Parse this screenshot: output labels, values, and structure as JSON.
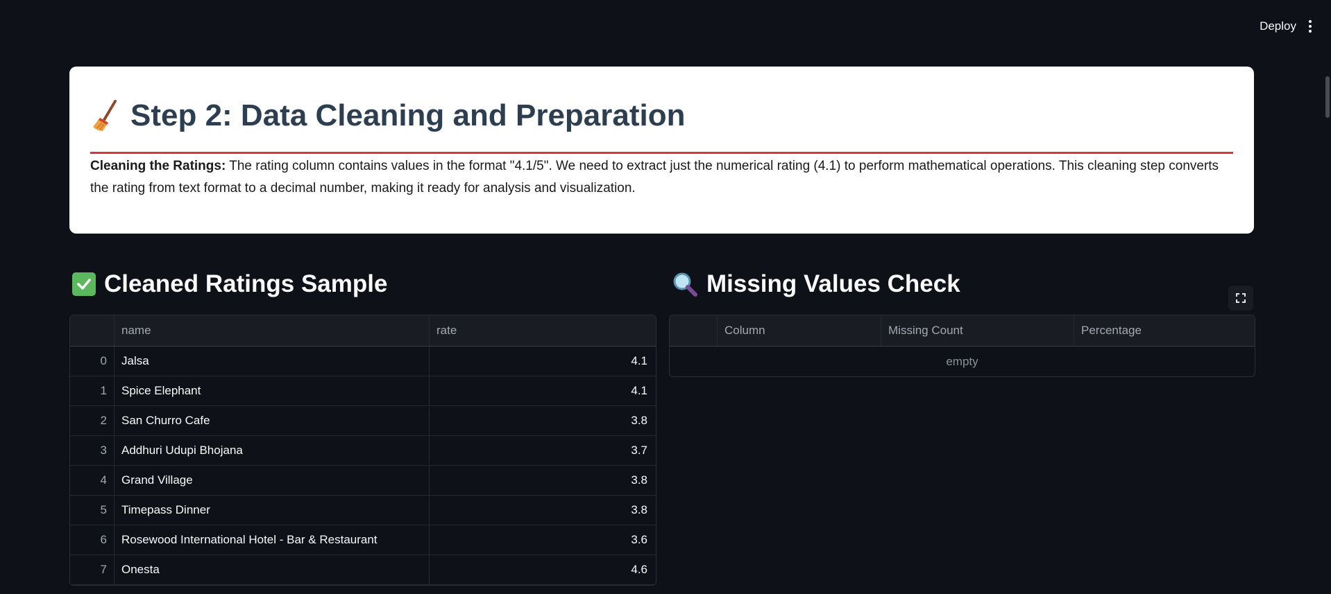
{
  "toolbar": {
    "deploy_label": "Deploy"
  },
  "header_card": {
    "title": "Step 2: Data Cleaning and Preparation",
    "title_icon": "broom-icon",
    "desc_bold": "Cleaning the Ratings:",
    "desc_text": " The rating column contains values in the format \"4.1/5\". We need to extract just the numerical rating (4.1) to perform mathematical operations. This cleaning step converts the rating from text format to a decimal number, making it ready for analysis and visualization."
  },
  "ratings_section": {
    "title": "Cleaned Ratings Sample",
    "icon": "check-mark-icon",
    "columns": [
      "",
      "name",
      "rate"
    ],
    "rows": [
      {
        "index": "0",
        "name": "Jalsa",
        "rate": "4.1"
      },
      {
        "index": "1",
        "name": "Spice Elephant",
        "rate": "4.1"
      },
      {
        "index": "2",
        "name": "San Churro Cafe",
        "rate": "3.8"
      },
      {
        "index": "3",
        "name": "Addhuri Udupi Bhojana",
        "rate": "3.7"
      },
      {
        "index": "4",
        "name": "Grand Village",
        "rate": "3.8"
      },
      {
        "index": "5",
        "name": "Timepass Dinner",
        "rate": "3.8"
      },
      {
        "index": "6",
        "name": "Rosewood International Hotel - Bar & Restaurant",
        "rate": "3.6"
      },
      {
        "index": "7",
        "name": "Onesta",
        "rate": "4.6"
      }
    ]
  },
  "missing_section": {
    "title": "Missing Values Check",
    "icon": "magnifier-icon",
    "columns": [
      "",
      "Column",
      "Missing Count",
      "Percentage"
    ],
    "empty_label": "empty"
  },
  "colors": {
    "background": "#0e1117",
    "card": "#ffffff",
    "title": "#2c3e50",
    "accent_line": "#e0303f"
  }
}
